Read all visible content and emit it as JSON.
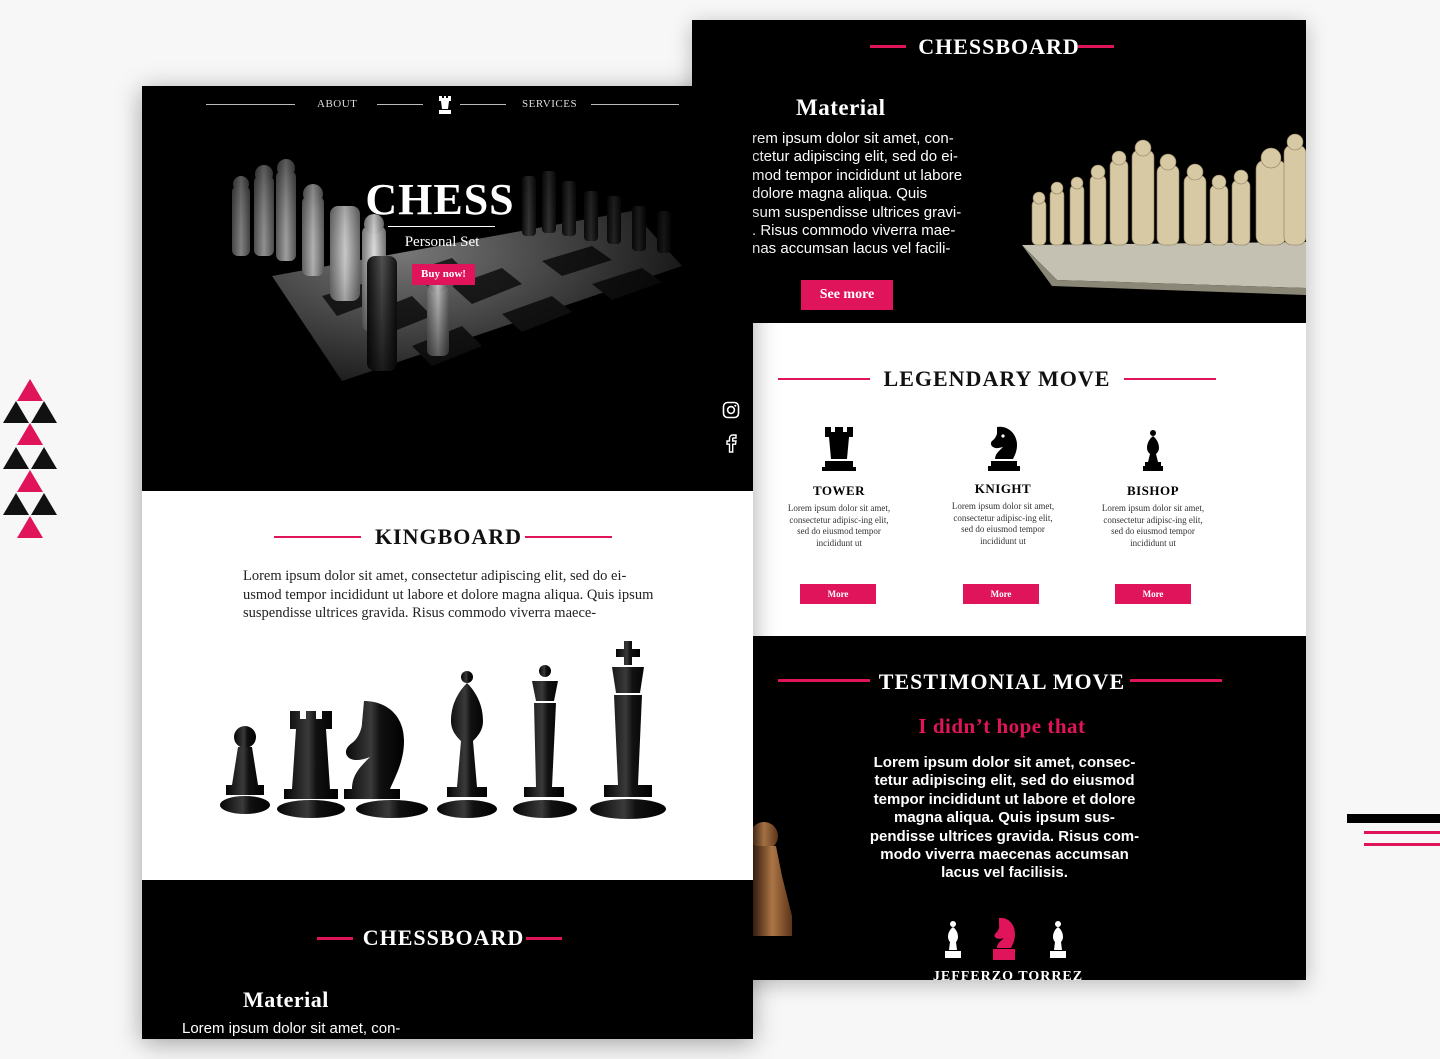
{
  "colors": {
    "accent": "#e0145a",
    "dark": "#000000",
    "light": "#ffffff"
  },
  "front": {
    "nav": {
      "about": "ABOUT",
      "services": "SERVICES",
      "logo_icon": "rook-icon"
    },
    "hero": {
      "title": "CHESS",
      "subtitle": "Personal Set",
      "cta": "Buy now!"
    },
    "social": [
      "instagram-icon",
      "facebook-icon"
    ],
    "kingboard": {
      "title": "KINGBOARD",
      "text": "Lorem ipsum dolor sit amet, consectetur adipiscing elit, sed do ei-usmod tempor incididunt ut labore et dolore magna aliqua. Quis ipsum suspendisse ultrices gravida. Risus commodo viverra maece-"
    },
    "chessboard": {
      "title": "CHESSBOARD",
      "material_title": "Material",
      "text": "Lorem ipsum dolor sit amet, con-"
    }
  },
  "back": {
    "chessboard": {
      "title": "CHESSBOARD",
      "material_title": "Material",
      "lines": [
        "rem ipsum dolor sit amet, con-",
        "ctetur adipiscing elit, sed do ei-",
        "mod tempor incididunt ut labore",
        "dolore magna aliqua. Quis",
        "sum suspendisse ultrices gravi-",
        ". Risus commodo viverra mae-",
        "nas accumsan lacus vel facili-"
      ],
      "cta": "See more"
    },
    "legendary": {
      "title": "LEGENDARY MOVE",
      "items": [
        {
          "name": "TOWER",
          "text": "Lorem ipsum dolor sit amet, consectetur adipisc-ing elit, sed do eiusmod tempor incididunt ut",
          "cta": "More",
          "icon": "rook-icon"
        },
        {
          "name": "KNIGHT",
          "text": "Lorem ipsum dolor sit amet, consectetur adipisc-ing elit, sed do eiusmod tempor incididunt ut",
          "cta": "More",
          "icon": "knight-icon"
        },
        {
          "name": "BISHOP",
          "text": "Lorem ipsum dolor sit amet, consectetur adipisc-ing elit, sed do eiusmod tempor incididunt ut",
          "cta": "More",
          "icon": "bishop-icon"
        }
      ]
    },
    "testimonial": {
      "title": "TESTIMONIAL MOVE",
      "quote_title": "I didn’t hope that",
      "lines": [
        "Lorem ipsum dolor sit amet, consec-",
        "tetur adipiscing elit, sed do eiusmod",
        "tempor incididunt ut labore et dolore",
        "magna aliqua. Quis ipsum sus-",
        "pendisse ultrices gravida. Risus com-",
        "modo viverra maecenas accumsan",
        "lacus vel facilisis."
      ],
      "author": "JEFFERZO TORREZ"
    }
  }
}
